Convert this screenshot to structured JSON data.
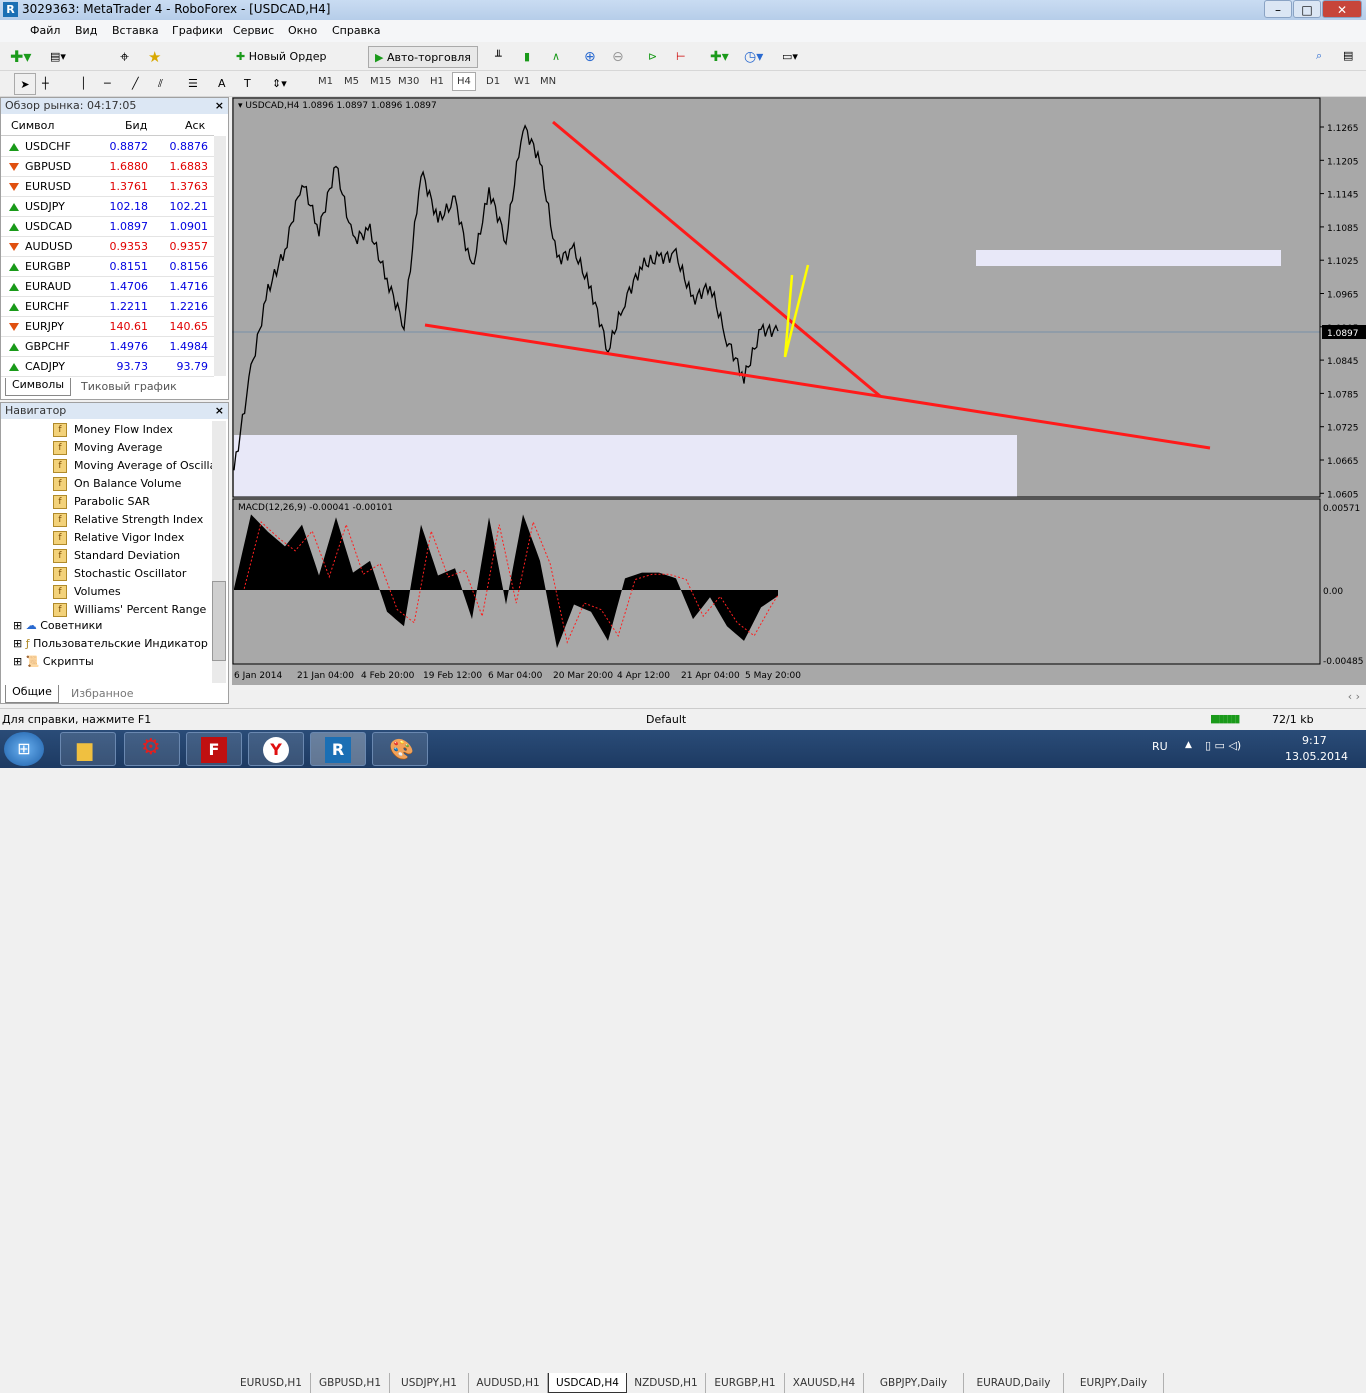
{
  "window": {
    "title": "3029363: MetaTrader 4 - RoboForex - [USDCAD,H4]",
    "minimize": "–",
    "maximize": "□",
    "close": "✕"
  },
  "menu": [
    "Файл",
    "Вид",
    "Вставка",
    "Графики",
    "Сервис",
    "Окно",
    "Справка"
  ],
  "toolbar": {
    "new_order": "Новый Ордер",
    "autotrading": "Авто-торговля",
    "search_placeholder": ""
  },
  "timeframes": [
    "M1",
    "M5",
    "M15",
    "M30",
    "H1",
    "H4",
    "D1",
    "W1",
    "MN"
  ],
  "active_timeframe": "H4",
  "market_watch": {
    "title": "Обзор рынка: 04:17:05",
    "col_symbol": "Символ",
    "col_bid": "Бид",
    "col_ask": "Аск",
    "rows": [
      {
        "symbol": "USDCHF",
        "bid": "0.8872",
        "ask": "0.8876",
        "dir": "up"
      },
      {
        "symbol": "GBPUSD",
        "bid": "1.6880",
        "ask": "1.6883",
        "dir": "down"
      },
      {
        "symbol": "EURUSD",
        "bid": "1.3761",
        "ask": "1.3763",
        "dir": "down"
      },
      {
        "symbol": "USDJPY",
        "bid": "102.18",
        "ask": "102.21",
        "dir": "up"
      },
      {
        "symbol": "USDCAD",
        "bid": "1.0897",
        "ask": "1.0901",
        "dir": "up"
      },
      {
        "symbol": "AUDUSD",
        "bid": "0.9353",
        "ask": "0.9357",
        "dir": "down"
      },
      {
        "symbol": "EURGBP",
        "bid": "0.8151",
        "ask": "0.8156",
        "dir": "up"
      },
      {
        "symbol": "EURAUD",
        "bid": "1.4706",
        "ask": "1.4716",
        "dir": "up"
      },
      {
        "symbol": "EURCHF",
        "bid": "1.2211",
        "ask": "1.2216",
        "dir": "up"
      },
      {
        "symbol": "EURJPY",
        "bid": "140.61",
        "ask": "140.65",
        "dir": "down"
      },
      {
        "symbol": "GBPCHF",
        "bid": "1.4976",
        "ask": "1.4984",
        "dir": "up"
      },
      {
        "symbol": "CADJPY",
        "bid": "93.73",
        "ask": "93.79",
        "dir": "up"
      }
    ],
    "tabs": [
      "Символы",
      "Тиковый график"
    ]
  },
  "navigator": {
    "title": "Навигатор",
    "indicators": [
      "Money Flow Index",
      "Moving Average",
      "Moving Average of Oscilla",
      "On Balance Volume",
      "Parabolic SAR",
      "Relative Strength Index",
      "Relative Vigor Index",
      "Standard Deviation",
      "Stochastic Oscillator",
      "Volumes",
      "Williams' Percent Range"
    ],
    "folders": [
      "Советники",
      "Пользовательские Индикатор",
      "Скрипты"
    ],
    "tabs": [
      "Общие",
      "Избранное"
    ]
  },
  "chart": {
    "header": "USDCADH4",
    "header_text": "USDCAD,H4  1.0896 1.0897 1.0896 1.0897",
    "macd_label": "MACD(12,26,9) -0.00041 -0.00101",
    "current_price": "1.0897",
    "price_ticks": [
      "1.1265",
      "1.1205",
      "1.1145",
      "1.1085",
      "1.1025",
      "1.0965",
      "1.0905",
      "1.0845",
      "1.0785",
      "1.0725",
      "1.0665",
      "1.0605"
    ],
    "macd_ticks": [
      "0.00571",
      "0.00",
      "-0.00485"
    ],
    "time_ticks": [
      "6 Jan 2014",
      "21 Jan 04:00",
      "4 Feb 20:00",
      "19 Feb 12:00",
      "6 Mar 04:00",
      "20 Mar 20:00",
      "4 Apr 12:00",
      "21 Apr 04:00",
      "5 May 20:00"
    ],
    "colors": {
      "bg": "#a8a8a8",
      "price": "#000000",
      "trendline": "#ff1a1a",
      "projection": "#ffff00",
      "zone": "#e8e8f8"
    }
  },
  "chart_data": {
    "type": "line",
    "title": "USDCAD,H4",
    "ylim": [
      1.0605,
      1.1265
    ],
    "close": [
      1.0646,
      1.0827,
      1.0971,
      1.1043,
      1.1169,
      1.1079,
      1.1196,
      1.1061,
      1.1079,
      1.0989,
      1.0908,
      1.1187,
      1.1097,
      1.1133,
      1.1007,
      1.1151,
      1.1061,
      1.1269,
      1.1205,
      1.1025,
      1.1043,
      1.0971,
      1.0863,
      1.0953,
      1.1016,
      1.1029,
      1.1034,
      1.0953,
      1.098,
      1.0881,
      1.0812,
      1.0899,
      1.0897
    ],
    "macd": [
      0.0001,
      0.0052,
      0.004,
      0.003,
      0.0045,
      0.001,
      0.005,
      0.0012,
      0.002,
      -0.0015,
      -0.0025,
      0.0045,
      0.001,
      0.0015,
      -0.002,
      0.005,
      -0.001,
      0.0052,
      0.002,
      -0.004,
      -0.001,
      -0.0015,
      -0.0035,
      0.0008,
      0.0012,
      0.0012,
      0.0008,
      -0.002,
      -0.0005,
      -0.0025,
      -0.0035,
      -0.0012,
      -0.0004
    ]
  },
  "chart_tabs": [
    "EURUSD,H1",
    "GBPUSD,H1",
    "USDJPY,H1",
    "AUDUSD,H1",
    "USDCAD,H4",
    "NZDUSD,H1",
    "EURGBP,H1",
    "XAUUSD,H4",
    "GBPJPY,Daily",
    "EURAUD,Daily",
    "EURJPY,Daily"
  ],
  "status": {
    "help": "Для справки, нажмите F1",
    "profile": "Default",
    "traffic": "72/1 kb"
  },
  "taskbar": {
    "lang": "RU",
    "time": "9:17",
    "date": "13.05.2014"
  }
}
